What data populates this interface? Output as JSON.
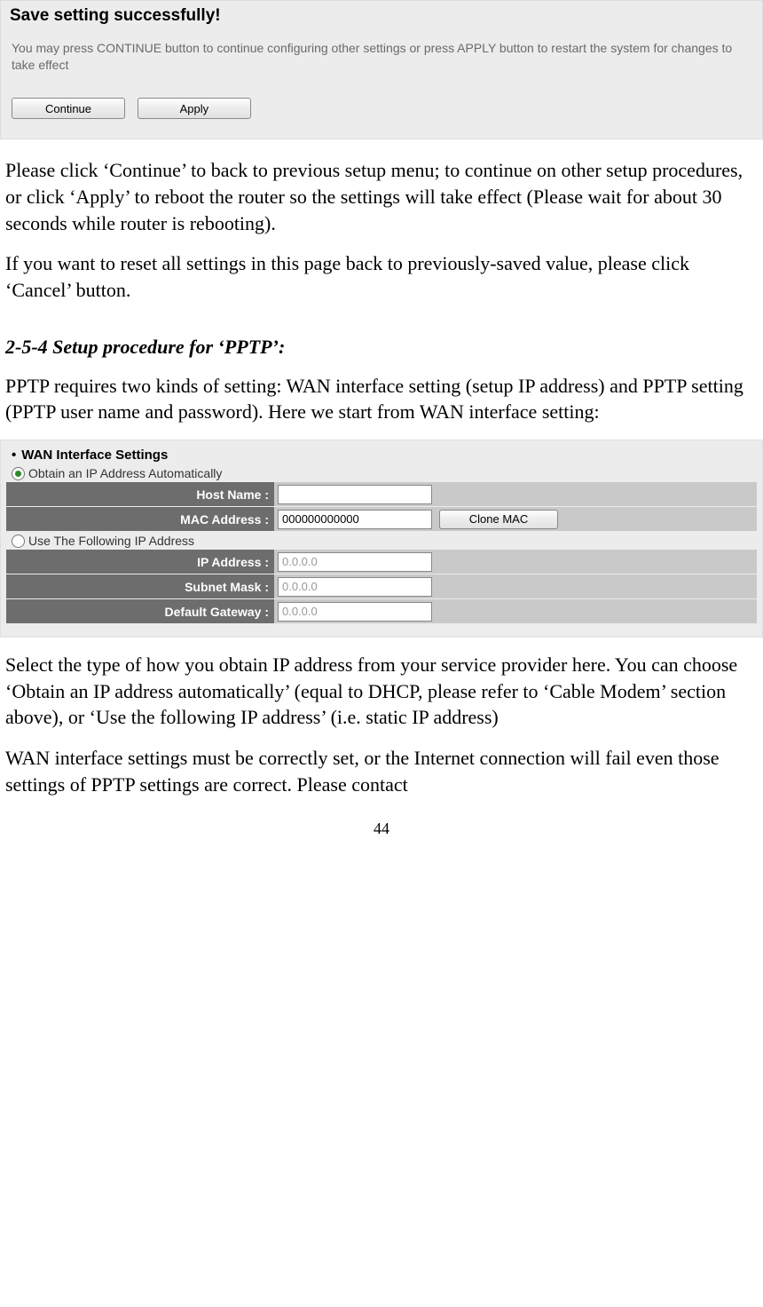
{
  "save_panel": {
    "title": "Save setting successfully!",
    "description": "You may press CONTINUE button to continue configuring other settings or press APPLY button to restart the system for changes to take effect",
    "continue_label": "Continue",
    "apply_label": "Apply"
  },
  "para1": "Please click ‘Continue’ to back to previous setup menu; to continue on other setup procedures, or click ‘Apply’ to reboot the router so the settings will take effect (Please wait for about 30 seconds while router is rebooting).",
  "para2": "If you want to reset all settings in this page back to previously-saved value, please click ‘Cancel’ button.",
  "section_heading": "2-5-4 Setup procedure for ‘PPTP’:",
  "para3": "PPTP requires two kinds of setting: WAN interface setting (setup IP address) and PPTP setting (PPTP user name and password). Here we start from WAN interface setting:",
  "wan": {
    "header": "WAN Interface Settings",
    "radio_auto": "Obtain an IP Address Automatically",
    "radio_static": "Use The Following IP Address",
    "host_name_label": "Host Name :",
    "host_name_value": "",
    "mac_label": "MAC Address :",
    "mac_value": "000000000000",
    "clone_mac_label": "Clone MAC",
    "ip_label": "IP Address :",
    "ip_value": "0.0.0.0",
    "subnet_label": "Subnet Mask :",
    "subnet_value": "0.0.0.0",
    "gateway_label": "Default Gateway :",
    "gateway_value": "0.0.0.0"
  },
  "para4": "Select the type of how you obtain IP address from your service provider here. You can choose ‘Obtain an IP address automatically’ (equal to DHCP, please refer to ‘Cable Modem’ section above), or ‘Use the following IP address’ (i.e. static IP address)",
  "para5": "WAN interface settings must be correctly set, or the Internet connection will fail even those settings of PPTP settings are correct. Please contact",
  "page_number": "44"
}
